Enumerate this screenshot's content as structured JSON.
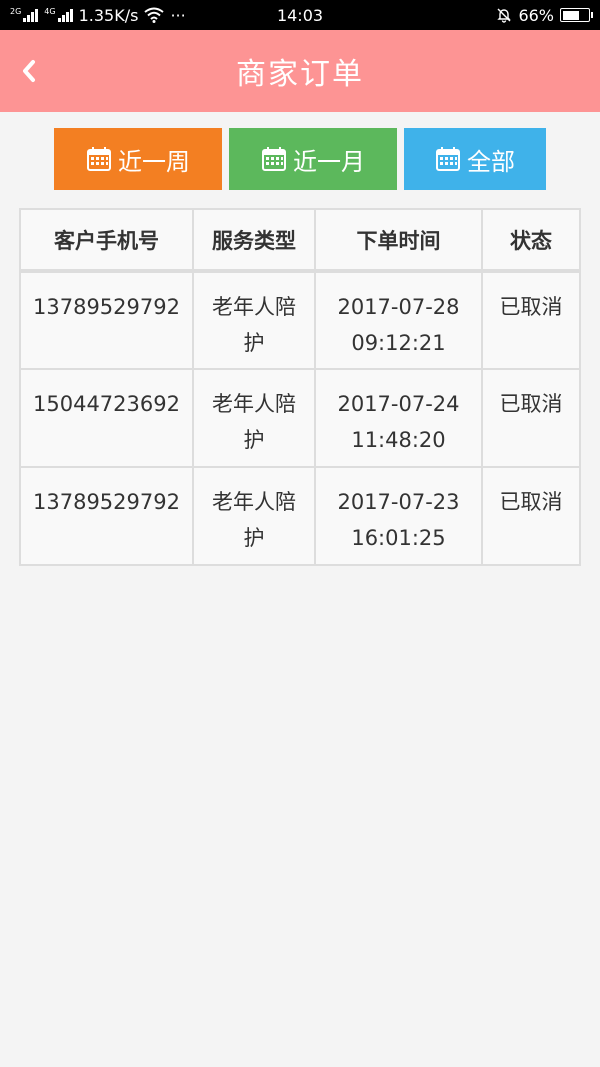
{
  "status_bar": {
    "net_2g": "2G",
    "net_4g": "4G",
    "speed": "1.35K/s",
    "more": "···",
    "time": "14:03",
    "battery_pct": "66%",
    "battery_level": 0.66
  },
  "header": {
    "title": "商家订单",
    "back_icon": "chevron-left-icon"
  },
  "filters": [
    {
      "label": "近一周",
      "icon": "calendar-icon",
      "color": "#f37f22"
    },
    {
      "label": "近一月",
      "icon": "calendar-icon",
      "color": "#5cb85c"
    },
    {
      "label": "全部",
      "icon": "calendar-icon",
      "color": "#3fb2ea"
    }
  ],
  "table": {
    "columns": [
      "客户手机号",
      "服务类型",
      "下单时间",
      "状态"
    ],
    "rows": [
      {
        "phone": "13789529792",
        "service": "老年人陪护",
        "time": "2017-07-28 09:12:21",
        "status": "已取消"
      },
      {
        "phone": "15044723692",
        "service": "老年人陪护",
        "time": "2017-07-24 11:48:20",
        "status": "已取消"
      },
      {
        "phone": "13789529792",
        "service": "老年人陪护",
        "time": "2017-07-23 16:01:25",
        "status": "已取消"
      }
    ]
  },
  "colors": {
    "header_bg": "#fd9494",
    "page_bg": "#f4f4f4"
  }
}
